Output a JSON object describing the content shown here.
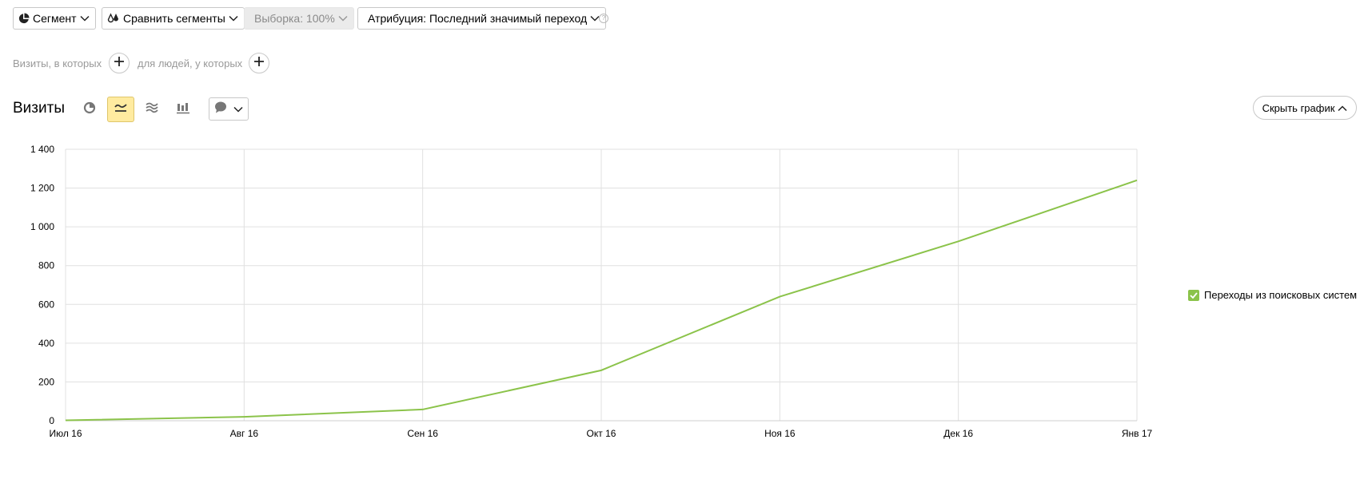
{
  "toolbar": {
    "segment_label": "Сегмент",
    "compare_label": "Сравнить сегменты",
    "sample_label": "Выборка: 100%",
    "attribution_label": "Атрибуция: Последний значимый переход",
    "help_glyph": "?"
  },
  "filters": {
    "visits_label": "Визиты, в которых",
    "people_label": "для людей, у которых"
  },
  "report": {
    "title": "Визиты",
    "hide_chart_label": "Скрыть график"
  },
  "colors": {
    "series": "#8bc34a",
    "active_button": "#ffeba0",
    "grid": "#e0e0e0"
  },
  "chart_data": {
    "type": "line",
    "categories": [
      "Июл 16",
      "Авг 16",
      "Сен 16",
      "Окт 16",
      "Ноя 16",
      "Дек 16",
      "Янв 17"
    ],
    "series": [
      {
        "name": "Переходы из поисковых систем",
        "values": [
          2,
          20,
          58,
          260,
          640,
          925,
          1240
        ]
      }
    ],
    "y_ticks": [
      0,
      200,
      400,
      600,
      800,
      1000,
      1200,
      1400
    ],
    "y_tick_labels": [
      "0",
      "200",
      "400",
      "600",
      "800",
      "1 000",
      "1 200",
      "1 400"
    ],
    "ylim": [
      0,
      1400
    ],
    "grid": true,
    "legend_position": "right"
  }
}
